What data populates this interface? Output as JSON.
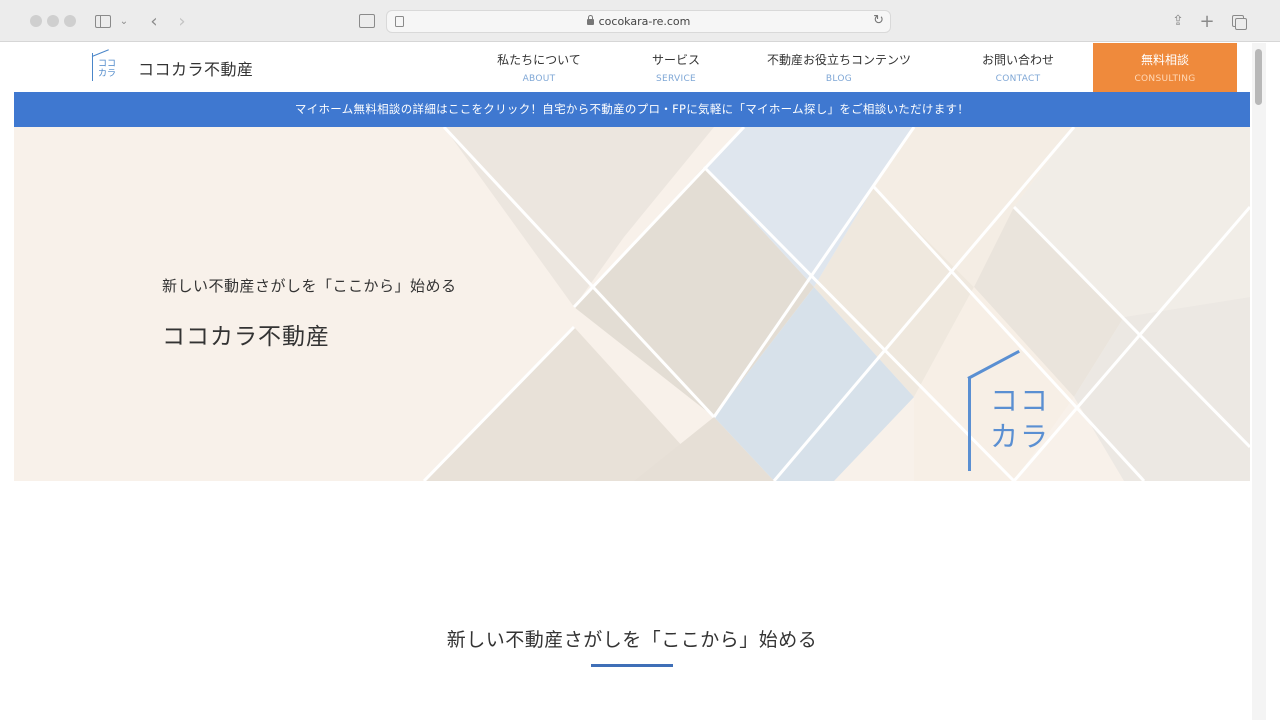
{
  "browser": {
    "url": "cocokara-re.com",
    "icons": [
      "sidebar-icon",
      "chevron-down-icon",
      "back-icon",
      "forward-icon",
      "reader-icon",
      "lock-icon",
      "reload-icon",
      "share-icon",
      "plus-icon",
      "tabs-icon"
    ]
  },
  "header": {
    "logo_mark": "ココカラ",
    "logo_name": "ココカラ不動産",
    "nav": [
      {
        "jp": "私たちについて",
        "en": "ABOUT"
      },
      {
        "jp": "サービス",
        "en": "SERVICE"
      },
      {
        "jp": "不動産お役立ちコンテンツ",
        "en": "BLOG"
      },
      {
        "jp": "お問い合わせ",
        "en": "CONTACT"
      },
      {
        "jp": "無料相談",
        "en": "CONSULTING"
      }
    ]
  },
  "banner": {
    "text": "マイホーム無料相談の詳細はここをクリック！自宅から不動産のプロ・FPに気軽に「マイホーム探し」をご相談いただけます！"
  },
  "hero": {
    "subtitle": "新しい不動産さがしを「ここから」始める",
    "title": "ココカラ不動産",
    "logo_text_line1": "ココ",
    "logo_text_line2": "カラ"
  },
  "section": {
    "title": "新しい不動産さがしを「ここから」始める"
  },
  "colors": {
    "accent_blue": "#3f78d0",
    "consult_orange": "#ef8a3c",
    "hero_bg": "#f8f1ea",
    "logo_blue": "#4a86c9"
  }
}
